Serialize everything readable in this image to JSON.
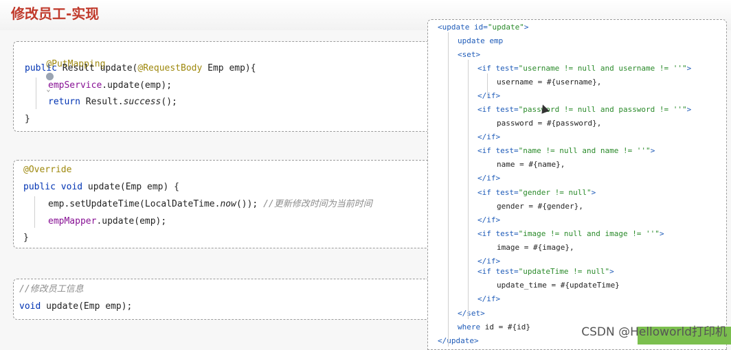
{
  "slide_title": "修改员工-实现",
  "controller": {
    "l1": "@PutMapping",
    "l2a": "public ",
    "l2b": "Result ",
    "l2c": "update(",
    "l2d": "@RequestBody",
    "l2e": " Emp emp){",
    "l3a": "empService",
    "l3b": ".update(emp);",
    "l4a": "return ",
    "l4b": "Result.",
    "l4c": "success",
    "l4d": "();",
    "l5": "}"
  },
  "service_impl": {
    "l1": "@Override",
    "l2a": "public void ",
    "l2b": "update(Emp emp) {",
    "l3a": "emp.setUpdateTime(LocalDateTime.",
    "l3b": "now",
    "l3c": "()); ",
    "l3d": "//更新修改时间为当前时间",
    "l4a": "empMapper",
    "l4b": ".update(emp);",
    "l5": "}"
  },
  "mapper": {
    "l1": "//修改员工信息",
    "l2a": "void ",
    "l2b": "update(Emp emp);"
  },
  "xml": [
    {
      "indent": 0,
      "parts": [
        [
          "tag",
          "<update "
        ],
        [
          "attr",
          "id="
        ],
        [
          "str",
          "\"update\""
        ],
        [
          "tag",
          ">"
        ]
      ]
    },
    {
      "indent": 1,
      "parts": [
        [
          "tag",
          "update emp"
        ]
      ]
    },
    {
      "indent": 1,
      "parts": [
        [
          "tag",
          "<set>"
        ]
      ]
    },
    {
      "indent": 2,
      "parts": [
        [
          "tag",
          "<if "
        ],
        [
          "attr",
          "test="
        ],
        [
          "str",
          "\"username != null and username != ''\""
        ],
        [
          "tag",
          ">"
        ]
      ]
    },
    {
      "indent": 3,
      "parts": [
        [
          "plain",
          "username = #{username},"
        ]
      ]
    },
    {
      "indent": 2,
      "parts": [
        [
          "tag",
          "</if>"
        ]
      ]
    },
    {
      "indent": 2,
      "parts": [
        [
          "tag",
          "<if "
        ],
        [
          "attr",
          "test="
        ],
        [
          "str",
          "\"password != null and password != ''\""
        ],
        [
          "tag",
          ">"
        ]
      ]
    },
    {
      "indent": 3,
      "parts": [
        [
          "plain",
          "password = #{password},"
        ]
      ]
    },
    {
      "indent": 2,
      "parts": [
        [
          "tag",
          "</if>"
        ]
      ]
    },
    {
      "indent": 2,
      "parts": [
        [
          "tag",
          "<if "
        ],
        [
          "attr",
          "test="
        ],
        [
          "str",
          "\"name != null and name != ''\""
        ],
        [
          "tag",
          ">"
        ]
      ]
    },
    {
      "indent": 3,
      "parts": [
        [
          "plain",
          "name = #{name},"
        ]
      ]
    },
    {
      "indent": 2,
      "parts": [
        [
          "tag",
          "</if>"
        ]
      ]
    },
    {
      "indent": 2,
      "parts": [
        [
          "tag",
          "<if "
        ],
        [
          "attr",
          "test="
        ],
        [
          "str",
          "\"gender != null\""
        ],
        [
          "tag",
          ">"
        ]
      ]
    },
    {
      "indent": 3,
      "parts": [
        [
          "plain",
          "gender = #{gender},"
        ]
      ]
    },
    {
      "indent": 2,
      "parts": [
        [
          "tag",
          "</if>"
        ]
      ]
    },
    {
      "indent": 2,
      "parts": [
        [
          "tag",
          "<if "
        ],
        [
          "attr",
          "test="
        ],
        [
          "str",
          "\"image != null and image != ''\""
        ],
        [
          "tag",
          ">"
        ]
      ]
    },
    {
      "indent": 3,
      "parts": [
        [
          "plain",
          "image = #{image},"
        ]
      ]
    },
    {
      "indent": 2,
      "parts": [
        [
          "tag",
          "</if>"
        ]
      ]
    },
    {
      "indent": 2,
      "parts": [
        [
          "tag",
          "<if "
        ],
        [
          "attr",
          "test="
        ],
        [
          "str",
          "\"updateTime != null\""
        ],
        [
          "tag",
          ">"
        ]
      ]
    },
    {
      "indent": 3,
      "parts": [
        [
          "plain",
          "update_time = #{updateTime}"
        ]
      ]
    },
    {
      "indent": 2,
      "parts": [
        [
          "tag",
          "</if>"
        ]
      ]
    },
    {
      "indent": 1,
      "parts": [
        [
          "tag",
          "</set>"
        ]
      ]
    },
    {
      "indent": 1,
      "parts": [
        [
          "tag",
          "where "
        ],
        [
          "plain",
          "id = #{id}"
        ]
      ]
    },
    {
      "indent": 0,
      "parts": [
        [
          "tag",
          "</update>"
        ]
      ]
    }
  ],
  "watermark": "CSDN @Helloworld打印机"
}
